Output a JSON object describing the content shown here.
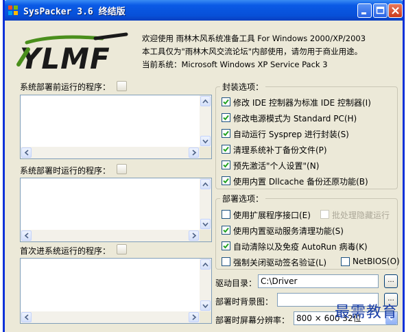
{
  "window": {
    "title": "SysPacker 3.6 终结版"
  },
  "logo": {
    "text": "YLMF"
  },
  "intro": {
    "line1": "欢迎使用 雨林木风系统准备工具 For Windows 2000/XP/2003",
    "line2": "本工具仅为\"雨林木风交流论坛\"内部使用，请勿用于商业用途。",
    "line3": "当前系统：Microsoft Windows XP Service Pack 3"
  },
  "left": {
    "pre_deploy_label": "系统部署前运行的程序：",
    "during_deploy_label": "系统部署时运行的程序：",
    "first_login_label": "首次进系统运行的程序：",
    "small_button_label": "..."
  },
  "package_options": {
    "title": "封装选项：",
    "items": [
      {
        "label": "修改 IDE 控制器为标准 IDE 控制器(I)",
        "checked": true
      },
      {
        "label": "修改电源模式为 Standard PC(H)",
        "checked": true
      },
      {
        "label": "自动运行 Sysprep 进行封装(S)",
        "checked": true
      },
      {
        "label": "清理系统补丁备份文件(P)",
        "checked": true
      },
      {
        "label": "预先激活\"个人设置\"(N)",
        "checked": true
      },
      {
        "label": "使用内置 Dllcache 备份还原功能(B)",
        "checked": true
      }
    ]
  },
  "deploy_options": {
    "title": "部署选项：",
    "ext_interface": {
      "label": "使用扩展程序接口(E)",
      "checked": false
    },
    "batch_hidden": {
      "label": "批处理隐藏运行",
      "checked": false,
      "disabled": true
    },
    "driver_cleanup": {
      "label": "使用内置驱动服务清理功能(S)",
      "checked": true
    },
    "autorun": {
      "label": "自动清除以及免疫 AutoRun 病毒(K)",
      "checked": true
    },
    "force_unsigned": {
      "label": "强制关闭驱动签名验证(L)",
      "checked": false
    },
    "netbios": {
      "label": "NetBIOS(O)",
      "checked": false
    }
  },
  "driver_dir": {
    "label": "驱动目录：",
    "value": "C:\\Driver",
    "browse": "..."
  },
  "background": {
    "label": "部署时背景图：",
    "value": "",
    "browse": "..."
  },
  "resolution": {
    "label": "部署时屏幕分辨率：",
    "value": "800 × 600 32位"
  },
  "watermark": {
    "text": "最需教育"
  },
  "colors": {
    "titlebar": "#0a5ae6",
    "frame": "#0831d9",
    "face": "#ece9d8",
    "close": "#c9391a"
  }
}
